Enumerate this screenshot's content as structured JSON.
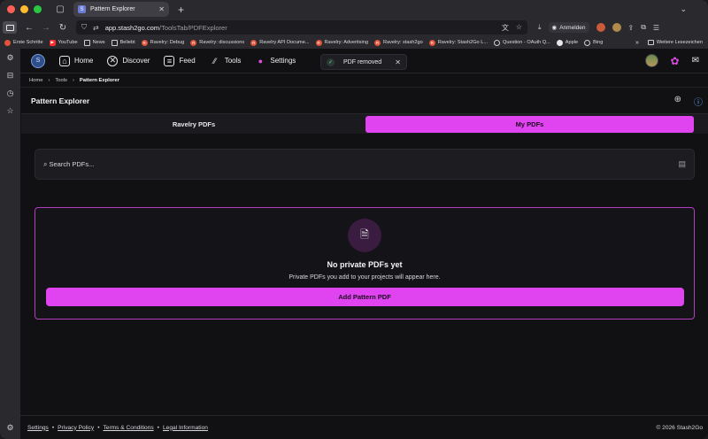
{
  "browser": {
    "tab_title": "Pattern Explorer",
    "tab_favicon": "S",
    "url_host": "app.stash2go.com",
    "url_path": "/ToolsTab/PDFExplorer",
    "signin_label": "Anmelden",
    "traffic_colors": [
      "#ff5f57",
      "#febc2e",
      "#28c840"
    ]
  },
  "bookmarks": {
    "items": [
      {
        "label": "Erste Schritte",
        "color": "#e0533a",
        "glyph": ""
      },
      {
        "label": "YouTube",
        "color": "#ff2d2d",
        "glyph": "▶"
      },
      {
        "label": "News",
        "color": "#2a2a2e",
        "glyph": "▭"
      },
      {
        "label": "Beliebt",
        "color": "#2a2a2e",
        "glyph": "▭"
      },
      {
        "label": "Ravelry: Debug",
        "color": "#e0533a",
        "glyph": "R"
      },
      {
        "label": "Ravelry: discussions",
        "color": "#e0533a",
        "glyph": "R"
      },
      {
        "label": "Ravelry API Docume...",
        "color": "#e0533a",
        "glyph": "R"
      },
      {
        "label": "Ravelry: Advertising",
        "color": "#e0533a",
        "glyph": "R"
      },
      {
        "label": "Ravelry: stash2go",
        "color": "#e0533a",
        "glyph": "R"
      },
      {
        "label": "Ravelry: Stash2Go L...",
        "color": "#e0533a",
        "glyph": "R"
      },
      {
        "label": "Question - OAuth Q...",
        "color": "#5d6bd6",
        "glyph": "◎"
      },
      {
        "label": "Apple",
        "color": "#e8e8ea",
        "glyph": ""
      },
      {
        "label": "Bing",
        "color": "#5d6bd6",
        "glyph": "◎"
      }
    ],
    "more_label": "Weitere Lesezeichen"
  },
  "nav": {
    "items": [
      {
        "label": "Home",
        "icon": "home-icon"
      },
      {
        "label": "Discover",
        "icon": "compass-icon"
      },
      {
        "label": "Feed",
        "icon": "feed-icon"
      },
      {
        "label": "Tools",
        "icon": "needles-icon"
      },
      {
        "label": "Settings",
        "icon": "settings-icon"
      }
    ]
  },
  "toast": {
    "text": "PDF removed"
  },
  "breadcrumb": {
    "home": "Home",
    "tools": "Tools",
    "current": "Pattern Explorer"
  },
  "page": {
    "title": "Pattern Explorer"
  },
  "segments": {
    "left": "Ravelry PDFs",
    "right": "My PDFs",
    "active": "right"
  },
  "search": {
    "placeholder": "Search PDFs..."
  },
  "empty": {
    "title": "No private PDFs yet",
    "description": "Private PDFs you add to your projects will appear here.",
    "button": "Add Pattern PDF"
  },
  "footer": {
    "settings": "Settings",
    "privacy": "Privacy Policy",
    "terms": "Terms & Conditions",
    "legal": "Legal Information",
    "copyright": "© 2026 Stash2Go"
  },
  "colors": {
    "accent": "#e043f0",
    "background": "#111114",
    "info": "#6aa8ff"
  }
}
